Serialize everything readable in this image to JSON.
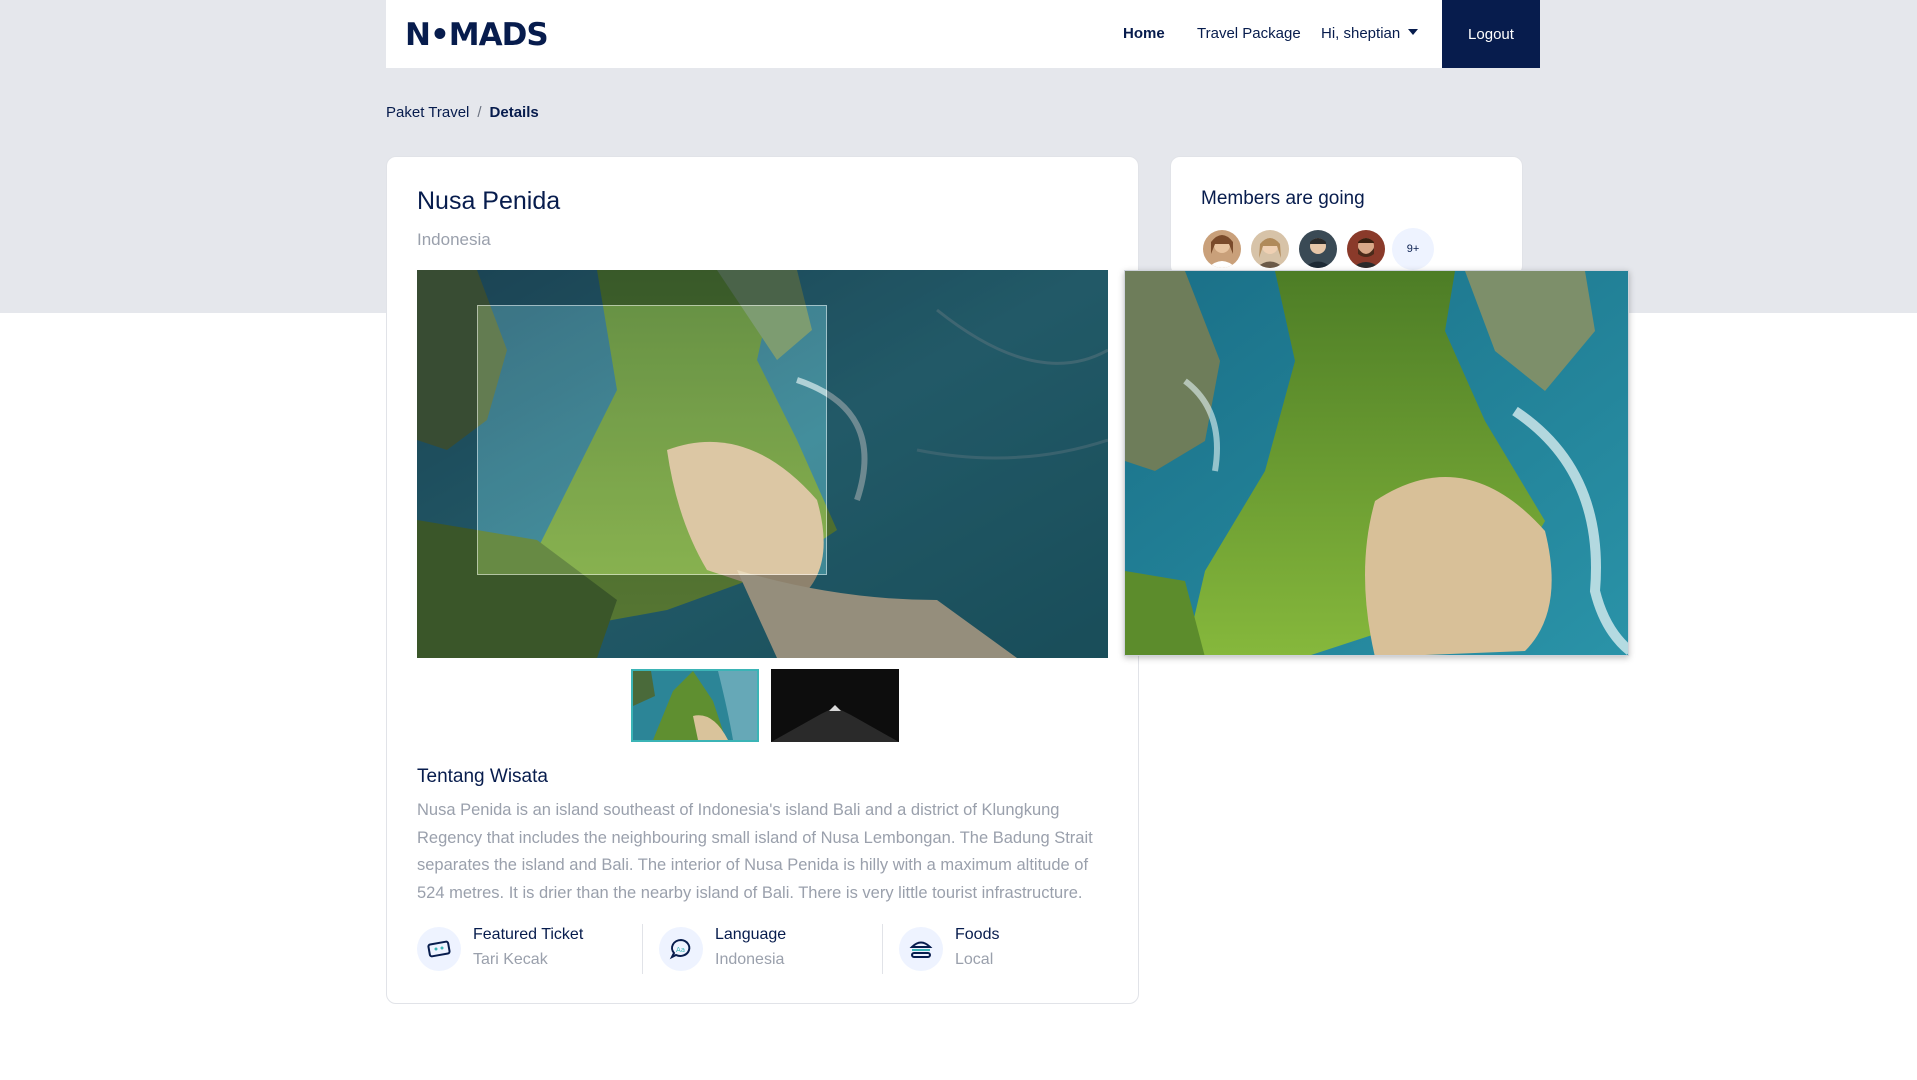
{
  "navbar": {
    "logo": "N•MADS",
    "links": [
      "Home",
      "Travel Package"
    ],
    "user_greeting": "Hi, sheptian",
    "logout_label": "Logout"
  },
  "breadcrumb": {
    "items": [
      "Paket Travel",
      "Details"
    ],
    "separator": "/"
  },
  "detail": {
    "title": "Nusa Penida",
    "country": "Indonesia",
    "about_title": "Tentang Wisata",
    "description": "Nusa Penida is an island southeast of Indonesia's island Bali and a district of Klungkung Regency that includes the neighbouring small island of Nusa Lembongan. The Badung Strait separates the island and Bali. The interior of Nusa Penida is hilly with a maximum altitude of 524 metres. It is drier than the nearby island of Bali. There is very little tourist infrastructure.",
    "features": [
      {
        "name": "Featured Ticket",
        "value": "Tari Kecak",
        "icon": "ticket-icon"
      },
      {
        "name": "Language",
        "value": "Indonesia",
        "icon": "language-chat-icon"
      },
      {
        "name": "Foods",
        "value": "Local",
        "icon": "burger-icon"
      }
    ]
  },
  "members": {
    "title": "Members are going",
    "more_label": "9+"
  },
  "colors": {
    "navy": "#071c4d",
    "muted": "#9aa0ac",
    "accent": "#3bb4b6",
    "page_bg": "#e5e7ec"
  }
}
